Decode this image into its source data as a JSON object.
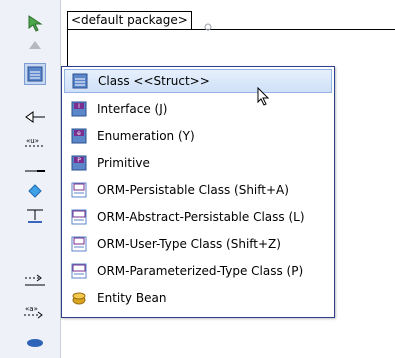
{
  "canvas": {
    "package_label": "<default package>"
  },
  "menu": {
    "items": [
      {
        "label": "Class <<Struct>>",
        "icon": "class-icon",
        "highlighted": true
      },
      {
        "label": "Interface (J)",
        "icon": "interface-icon",
        "highlighted": false
      },
      {
        "label": "Enumeration (Y)",
        "icon": "enumeration-icon",
        "highlighted": false
      },
      {
        "label": "Primitive",
        "icon": "primitive-icon",
        "highlighted": false
      },
      {
        "label": "ORM-Persistable Class (Shift+A)",
        "icon": "orm-persistable-icon",
        "highlighted": false
      },
      {
        "label": "ORM-Abstract-Persistable Class (L)",
        "icon": "orm-abstract-persistable-icon",
        "highlighted": false
      },
      {
        "label": "ORM-User-Type Class (Shift+Z)",
        "icon": "orm-user-type-icon",
        "highlighted": false
      },
      {
        "label": "ORM-Parameterized-Type Class (P)",
        "icon": "orm-parameterized-type-icon",
        "highlighted": false
      },
      {
        "label": "Entity Bean",
        "icon": "entity-bean-icon",
        "highlighted": false
      }
    ]
  },
  "palette": {
    "tools": [
      "selector-icon",
      "scroll-up-icon",
      "class-tool-icon",
      "generalization-icon",
      "usage-icon",
      "realization-icon",
      "diamond-icon",
      "dependency-icon",
      "association-icon",
      "anchor-icon",
      "stereotype-icon",
      "more-icon"
    ],
    "tool_labels": {
      "usage": "«u»",
      "stereotype": "«a»"
    }
  },
  "colors": {
    "menu_border": "#2f3f8f",
    "highlight": "#cfe0f8",
    "palette_bg": "#eef1f7",
    "accent": "#6f94cf"
  }
}
